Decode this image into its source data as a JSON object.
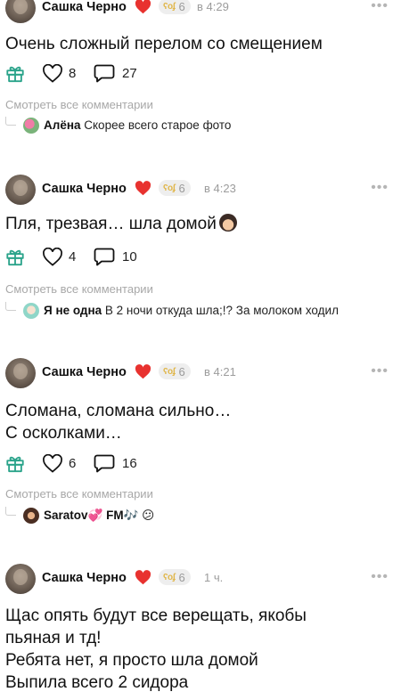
{
  "colors": {
    "heart": "#e8322f",
    "badge_crown": "#e0b64a",
    "muted": "#9c9c9c",
    "icon_green": "#2aa38a"
  },
  "posts": [
    {
      "author": "Сашка Черно",
      "level": "6",
      "time": "в 4:29",
      "text": "Очень сложный перелом со смещением",
      "likes": "8",
      "comments": "27",
      "view_all": "Смотреть все комментарии",
      "reply": {
        "user": "Алёна",
        "text": " Скорее всего старое фото",
        "avatar_icon": "flower-avatar"
      }
    },
    {
      "author": "Сашка Черно",
      "level": "6",
      "time": "в 4:23",
      "text": "Пля, трезвая… шла домой",
      "emoji": "woman-facepalm-emoji",
      "likes": "4",
      "comments": "10",
      "view_all": "Смотреть все комментарии",
      "reply": {
        "user": "Я не одна",
        "text": " В 2 ночи откуда шла;!? За молоком ходил",
        "avatar_icon": "anime-avatar"
      }
    },
    {
      "author": "Сашка Черно",
      "level": "6",
      "time": "в 4:21",
      "text": "Сломана, сломана сильно…\nС осколками…",
      "likes": "6",
      "comments": "16",
      "view_all": "Смотреть все комментарии",
      "reply": {
        "user": "Saratov💞 FM🎶",
        "text": " 😕",
        "avatar_icon": "girl-avatar"
      }
    },
    {
      "author": "Сашка Черно",
      "level": "6",
      "time": "1 ч.",
      "text": "Щас опять будут все верещать, якобы\nпьяная и тд!\nРебята нет, я просто шла домой\nВыпила всего 2 сидора"
    }
  ],
  "icons": {
    "gift": "gift-icon",
    "like": "heart-outline-icon",
    "comment": "comment-icon",
    "more": "more-dots-icon",
    "author_heart": "red-heart-icon",
    "level": "crown-icon"
  }
}
